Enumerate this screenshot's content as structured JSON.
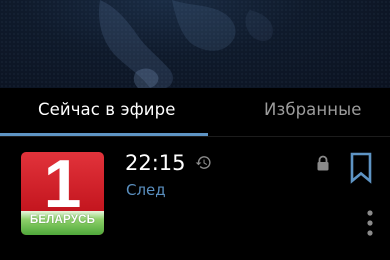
{
  "tabs": [
    {
      "label": "Сейчас в эфире",
      "active": true
    },
    {
      "label": "Избранные",
      "active": false
    }
  ],
  "channel": {
    "logo_number": "1",
    "logo_text": "БЕЛАРУСЬ",
    "time": "22:15",
    "next_label": "След"
  },
  "colors": {
    "accent": "#5e94c4",
    "link": "#5a8fbf",
    "logo_red": "#d4222a",
    "logo_green": "#5cb443",
    "background": "#000000"
  },
  "icons": {
    "history": "history-icon",
    "lock": "lock-icon",
    "bookmark": "bookmark-icon",
    "more": "more-vertical-icon"
  }
}
